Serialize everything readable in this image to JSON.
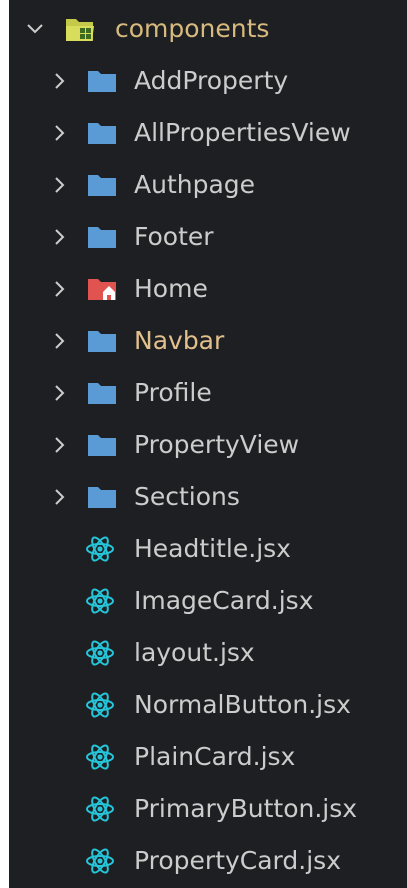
{
  "root": {
    "label": "components",
    "icon": "folder-components-open-icon",
    "expanded": true
  },
  "folders": [
    {
      "label": "AddProperty",
      "icon": "folder-icon",
      "color": "#5b9bd5"
    },
    {
      "label": "AllPropertiesView",
      "icon": "folder-icon",
      "color": "#5b9bd5"
    },
    {
      "label": "Authpage",
      "icon": "folder-icon",
      "color": "#5b9bd5"
    },
    {
      "label": "Footer",
      "icon": "folder-icon",
      "color": "#5b9bd5"
    },
    {
      "label": "Home",
      "icon": "folder-home-icon",
      "color": "#e0534f"
    },
    {
      "label": "Navbar",
      "icon": "folder-icon",
      "color": "#5b9bd5",
      "modified": true
    },
    {
      "label": "Profile",
      "icon": "folder-icon",
      "color": "#5b9bd5"
    },
    {
      "label": "PropertyView",
      "icon": "folder-icon",
      "color": "#5b9bd5"
    },
    {
      "label": "Sections",
      "icon": "folder-icon",
      "color": "#5b9bd5"
    }
  ],
  "files": [
    {
      "label": "Headtitle.jsx",
      "icon": "react-icon"
    },
    {
      "label": "ImageCard.jsx",
      "icon": "react-icon"
    },
    {
      "label": "layout.jsx",
      "icon": "react-icon"
    },
    {
      "label": "NormalButton.jsx",
      "icon": "react-icon"
    },
    {
      "label": "PlainCard.jsx",
      "icon": "react-icon"
    },
    {
      "label": "PrimaryButton.jsx",
      "icon": "react-icon"
    },
    {
      "label": "PropertyCard.jsx",
      "icon": "react-icon"
    }
  ],
  "colors": {
    "background": "#1e1f22",
    "text": "#cccccc",
    "folder": "#5b9bd5",
    "home_folder": "#e0534f",
    "react": "#26c6da",
    "modified": "#e2c08d"
  }
}
